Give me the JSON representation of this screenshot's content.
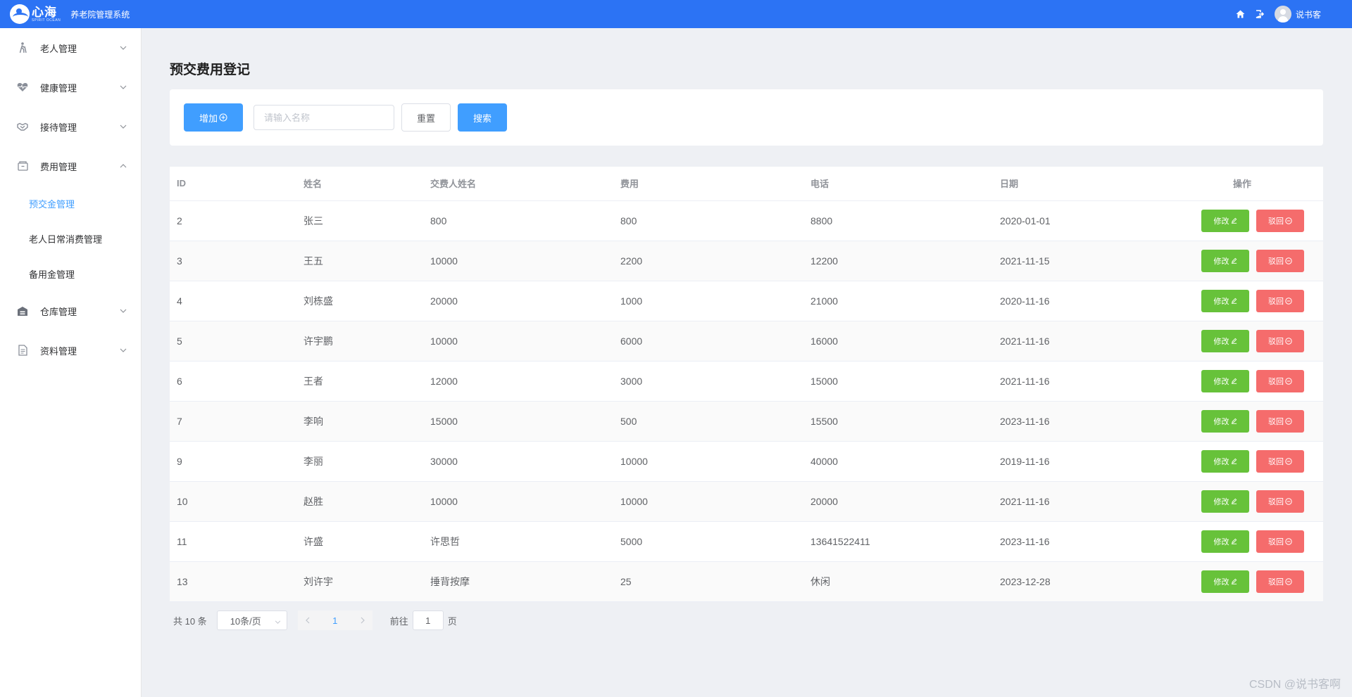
{
  "header": {
    "logo_text": "心海",
    "logo_subtext": "SPIRIT OCEAN",
    "system_title": "养老院管理系统",
    "username": "说书客",
    "icons": [
      "home-icon",
      "logout-icon",
      "user-avatar-icon"
    ],
    "background_color": "#2c73f4"
  },
  "sidebar": {
    "menus": [
      {
        "label": "老人管理",
        "icon": "walking-elder-icon",
        "expanded": false
      },
      {
        "label": "健康管理",
        "icon": "heart-icon",
        "expanded": false
      },
      {
        "label": "接待管理",
        "icon": "handshake-icon",
        "expanded": false
      },
      {
        "label": "费用管理",
        "icon": "cashbox-icon",
        "expanded": true
      },
      {
        "label": "仓库管理",
        "icon": "warehouse-icon",
        "expanded": false
      },
      {
        "label": "资料管理",
        "icon": "document-icon",
        "expanded": false
      }
    ],
    "fee_submenu": [
      {
        "label": "预交金管理",
        "active": true
      },
      {
        "label": "老人日常消费管理",
        "active": false
      },
      {
        "label": "备用金管理",
        "active": false
      }
    ]
  },
  "page": {
    "title": "预交费用登记"
  },
  "toolbar": {
    "add_label": "增加",
    "search_placeholder": "请输入名称",
    "search_value": "",
    "reset_label": "重置",
    "search_label": "搜索"
  },
  "table": {
    "columns": [
      "ID",
      "姓名",
      "交费人姓名",
      "费用",
      "电话",
      "日期",
      "操作"
    ],
    "edit_label": "修改",
    "reject_label": "驳回",
    "rows": [
      {
        "id": "2",
        "name": "张三",
        "payer": "800",
        "fee": "800",
        "phone": "8800",
        "date": "2020-01-01"
      },
      {
        "id": "3",
        "name": "王五",
        "payer": "10000",
        "fee": "2200",
        "phone": "12200",
        "date": "2021-11-15"
      },
      {
        "id": "4",
        "name": "刘栋盛",
        "payer": "20000",
        "fee": "1000",
        "phone": "21000",
        "date": "2020-11-16"
      },
      {
        "id": "5",
        "name": "许宇鹏",
        "payer": "10000",
        "fee": "6000",
        "phone": "16000",
        "date": "2021-11-16"
      },
      {
        "id": "6",
        "name": "王者",
        "payer": "12000",
        "fee": "3000",
        "phone": "15000",
        "date": "2021-11-16"
      },
      {
        "id": "7",
        "name": "李响",
        "payer": "15000",
        "fee": "500",
        "phone": "15500",
        "date": "2023-11-16"
      },
      {
        "id": "9",
        "name": "李丽",
        "payer": "30000",
        "fee": "10000",
        "phone": "40000",
        "date": "2019-11-16"
      },
      {
        "id": "10",
        "name": "赵胜",
        "payer": "10000",
        "fee": "10000",
        "phone": "20000",
        "date": "2021-11-16"
      },
      {
        "id": "11",
        "name": "许盛",
        "payer": "许思哲",
        "fee": "5000",
        "phone": "13641522411",
        "date": "2023-11-16"
      },
      {
        "id": "13",
        "name": "刘许宇",
        "payer": "捶背按摩",
        "fee": "25",
        "phone": "休闲",
        "date": "2023-12-28"
      }
    ]
  },
  "pagination": {
    "total_text": "共 10 条",
    "page_size": "10条/页",
    "current_page": "1",
    "goto_prefix": "前往",
    "goto_value": "1",
    "goto_suffix": "页"
  },
  "watermark": "CSDN @说书客啊",
  "colors": {
    "primary": "#409eff",
    "success": "#67c23a",
    "danger": "#f56c6c"
  }
}
